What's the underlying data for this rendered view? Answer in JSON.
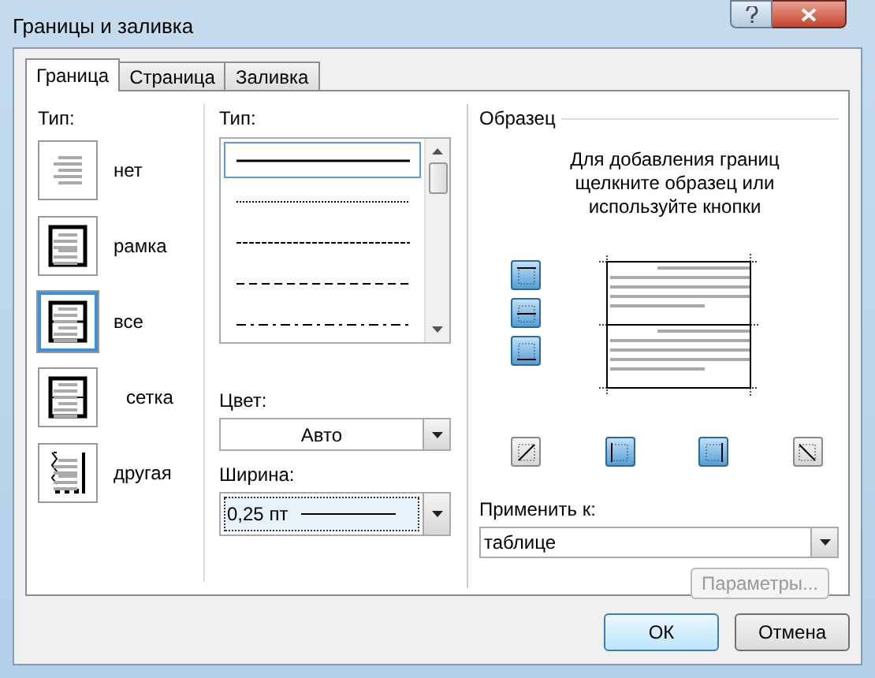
{
  "window": {
    "title": "Границы и заливка"
  },
  "tabs": [
    {
      "label": "Граница",
      "selected": true
    },
    {
      "label": "Страница",
      "selected": false
    },
    {
      "label": "Заливка",
      "selected": false
    }
  ],
  "setting": {
    "label": "Тип:",
    "items": [
      {
        "label": "нет",
        "kind": "none",
        "selected": false
      },
      {
        "label": "рамка",
        "kind": "box",
        "selected": false
      },
      {
        "label": "все",
        "kind": "all",
        "selected": true
      },
      {
        "label": "сетка",
        "kind": "grid",
        "selected": false
      },
      {
        "label": "другая",
        "kind": "custom",
        "selected": false
      }
    ]
  },
  "style": {
    "label": "Тип:",
    "items": [
      {
        "kind": "solid",
        "selected": true
      },
      {
        "kind": "dotted",
        "selected": false
      },
      {
        "kind": "dashed",
        "selected": false
      },
      {
        "kind": "long-dash",
        "selected": false
      },
      {
        "kind": "dash-dot",
        "selected": false
      }
    ]
  },
  "color": {
    "label": "Цвет:",
    "value": "Авто"
  },
  "width": {
    "label": "Ширина:",
    "value": "0,25 пт"
  },
  "preview": {
    "title": "Образец",
    "hint": "Для добавления границ щелкните образец или используйте кнопки",
    "buttons": [
      {
        "kind": "top",
        "on": true
      },
      {
        "kind": "inside-horizontal",
        "on": true
      },
      {
        "kind": "bottom",
        "on": true
      },
      {
        "kind": "diagonal-up",
        "on": false
      },
      {
        "kind": "left",
        "on": true
      },
      {
        "kind": "right",
        "on": true
      },
      {
        "kind": "diagonal-down",
        "on": false
      }
    ]
  },
  "apply": {
    "label": "Применить к:",
    "value": "таблице"
  },
  "options_button": {
    "label": "Параметры...",
    "disabled": true
  },
  "buttons": [
    {
      "label": "ОК",
      "default": true
    },
    {
      "label": "Отмена",
      "default": false
    }
  ]
}
